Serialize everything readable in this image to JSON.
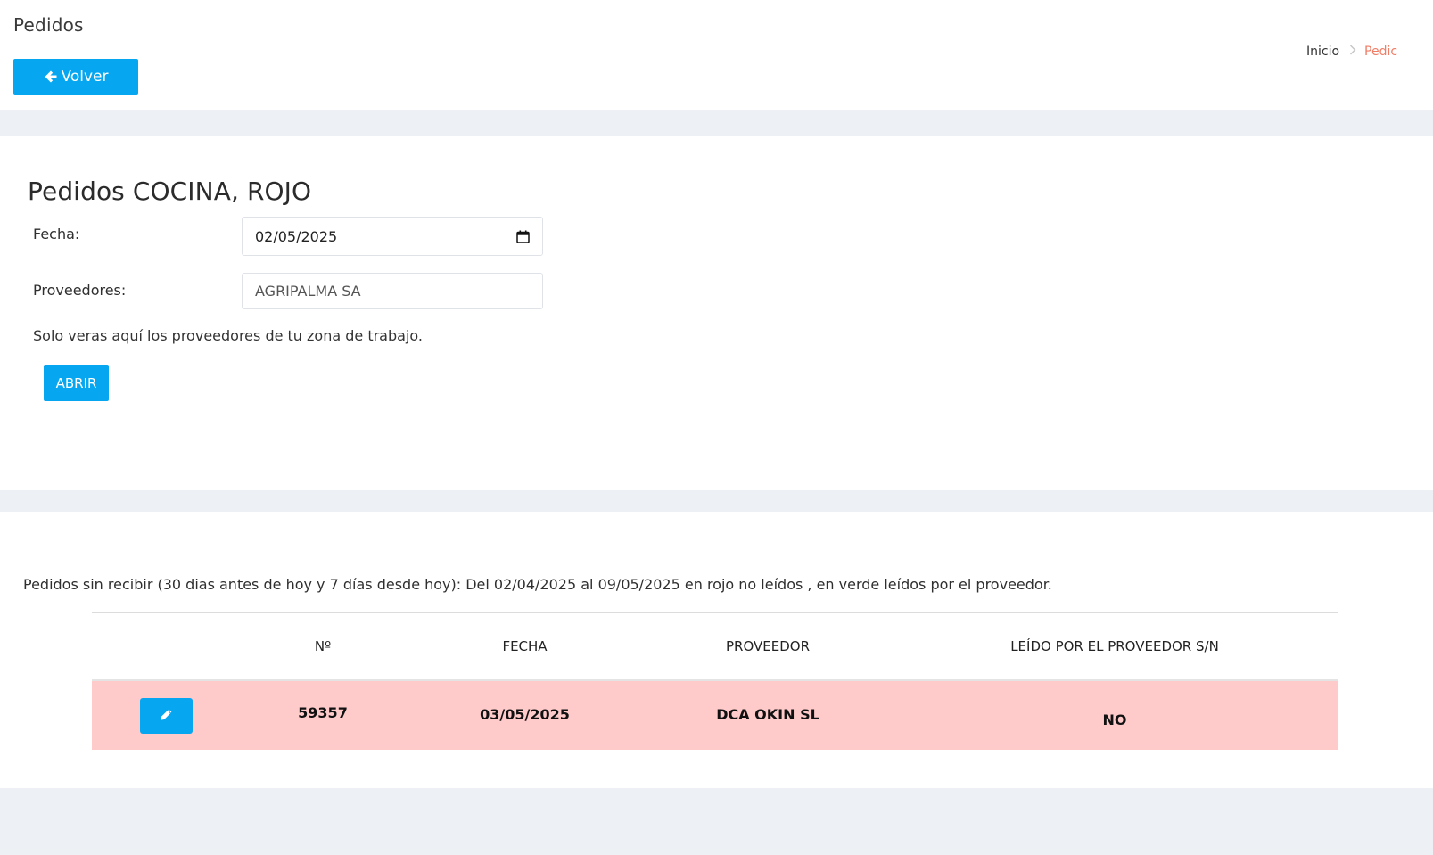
{
  "header": {
    "page_title": "Pedidos",
    "back_button_label": "Volver",
    "breadcrumb": {
      "home": "Inicio",
      "current": "Pedic"
    }
  },
  "form": {
    "title": "Pedidos COCINA, ROJO",
    "date_label": "Fecha:",
    "date_value": "02/05/2025",
    "supplier_label": "Proveedores:",
    "supplier_value": "AGRIPALMA SA",
    "help_text": "Solo veras aquí los proveedores de tu zona de trabajo.",
    "open_button_label": "ABRIR"
  },
  "orders": {
    "info_text": "Pedidos sin recibir (30 dias antes de hoy y 7 días desde hoy): Del 02/04/2025 al 09/05/2025 en rojo no leídos , en verde leídos por el proveedor.",
    "columns": [
      "",
      "Nº",
      "FECHA",
      "PROVEEDOR",
      "LEÍDO POR EL PROVEEDOR S/N"
    ],
    "rows": [
      {
        "numero": "59357",
        "fecha": "03/05/2025",
        "proveedor": "DCA OKIN SL",
        "leido": "NO"
      }
    ]
  },
  "colors": {
    "primary": "#06a7f0",
    "unread_row": "#ffcaca",
    "breadcrumb_active": "#f07d66",
    "background": "#edf0f4"
  },
  "icons": {
    "back": "arrow-left-icon",
    "calendar": "calendar-icon",
    "edit": "pencil-icon",
    "breadcrumb_separator": "chevron-right-icon"
  }
}
